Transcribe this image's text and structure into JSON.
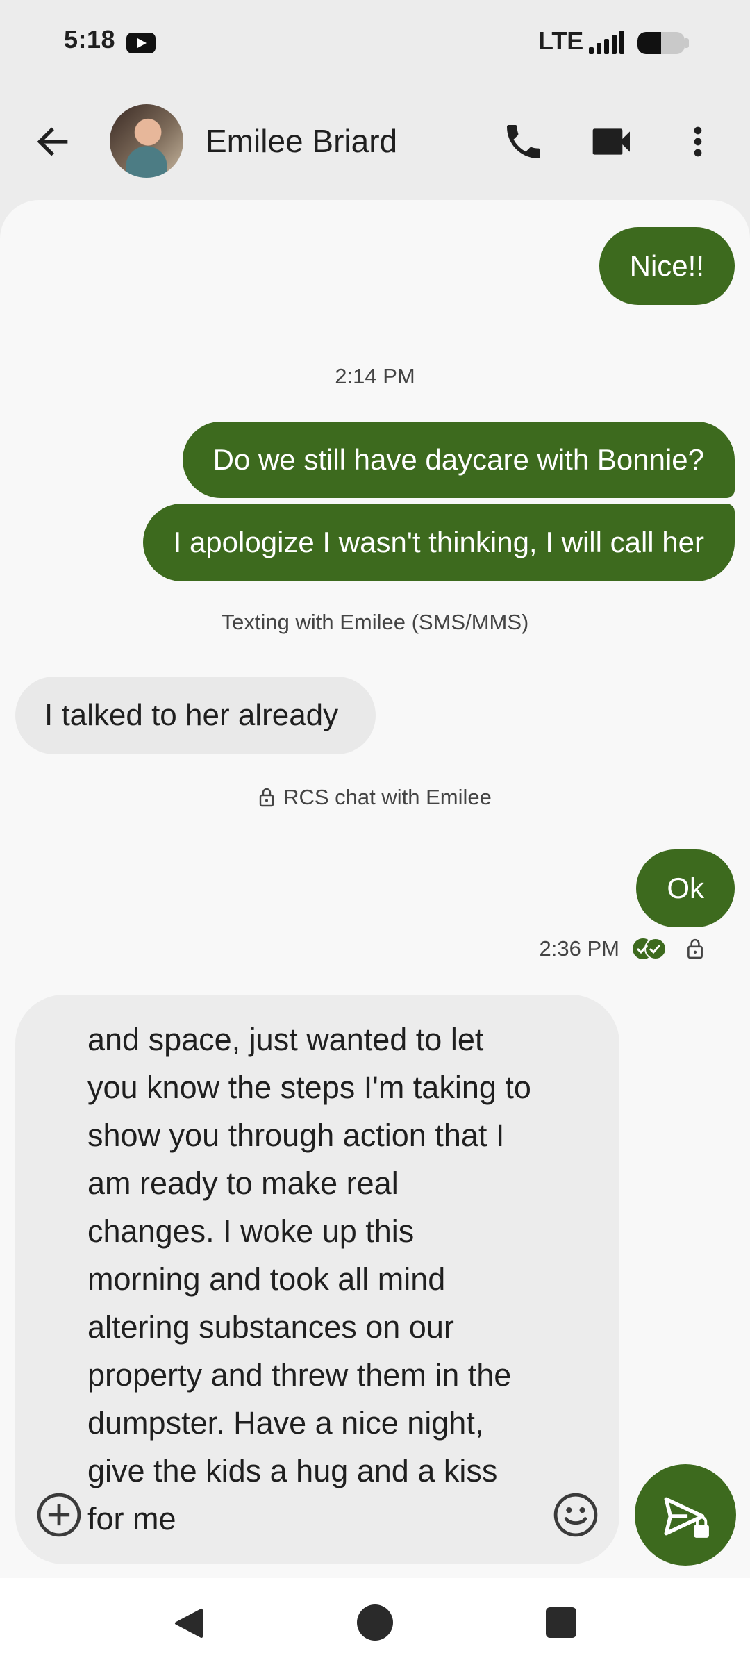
{
  "status_bar": {
    "time": "5:18",
    "network": "LTE",
    "battery_level": 0.5
  },
  "header": {
    "contact_name": "Emilee Briard",
    "icons": [
      "back-arrow-icon",
      "phone-icon",
      "video-camera-icon",
      "more-vert-icon"
    ]
  },
  "messages": {
    "out_nice": "Nice!!",
    "timestamp_1": "2:14 PM",
    "out_daycare": "Do we still have daycare with Bonnie?",
    "out_apologize": "I apologize I wasn't thinking, I will call her",
    "sms_notice": "Texting with Emilee (SMS/MMS)",
    "in_talked": "I talked to her already",
    "rcs_notice": "RCS chat with Emilee",
    "out_ok": "Ok",
    "timestamp_2": "2:36 PM"
  },
  "compose": {
    "text": "and space, just wanted to let you know the steps I'm taking to show you through action that I am ready to make real changes. I woke up this morning and took all mind altering substances on our property and threw them in the dumpster. Have a nice night, give the kids a hug and a kiss for me"
  },
  "colors": {
    "accent": "#3d6a1e",
    "incoming_bubble": "#e9e9e9",
    "panel": "#f8f8f8"
  }
}
